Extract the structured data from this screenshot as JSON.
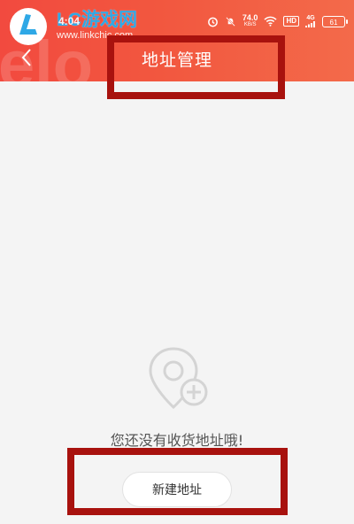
{
  "watermark": {
    "text": "LC游戏网",
    "url": "www.linkchic.com"
  },
  "status_bar": {
    "time": "4:04",
    "network_speed": "74.0",
    "speed_unit": "KB/S",
    "hd_label": "HD",
    "network_label": "4G",
    "battery": "61"
  },
  "header": {
    "title": "地址管理"
  },
  "empty_state": {
    "message": "您还没有收货地址哦!"
  },
  "actions": {
    "new_address_label": "新建地址"
  },
  "colors": {
    "header_red": "#f24a3f",
    "highlight_box": "#a8120e",
    "background": "#f4f4f4"
  }
}
